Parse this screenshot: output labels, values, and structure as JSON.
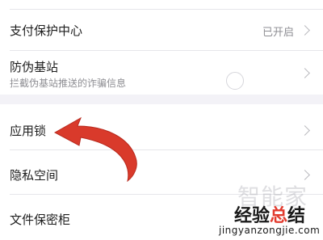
{
  "settings": {
    "rows": [
      {
        "title": "支付保护中心",
        "value": "已开启"
      },
      {
        "title": "防伪基站",
        "subtitle": "拦截伪基站推送的诈骗信息"
      },
      {
        "title": "应用锁"
      },
      {
        "title": "隐私空间"
      },
      {
        "title": "文件保密柜"
      }
    ]
  },
  "watermark": {
    "logo_text": "智能家",
    "main_text_part1": "经验",
    "main_text_accent": "总",
    "main_text_part2": "结",
    "url": "jingyanzongjie.com"
  },
  "colors": {
    "background": "#f3f2f7",
    "card": "#ffffff",
    "arrow": "#d93a2b",
    "accent": "#e23b2e"
  },
  "icons": [
    "chevron-right-icon",
    "red-curved-arrow"
  ]
}
